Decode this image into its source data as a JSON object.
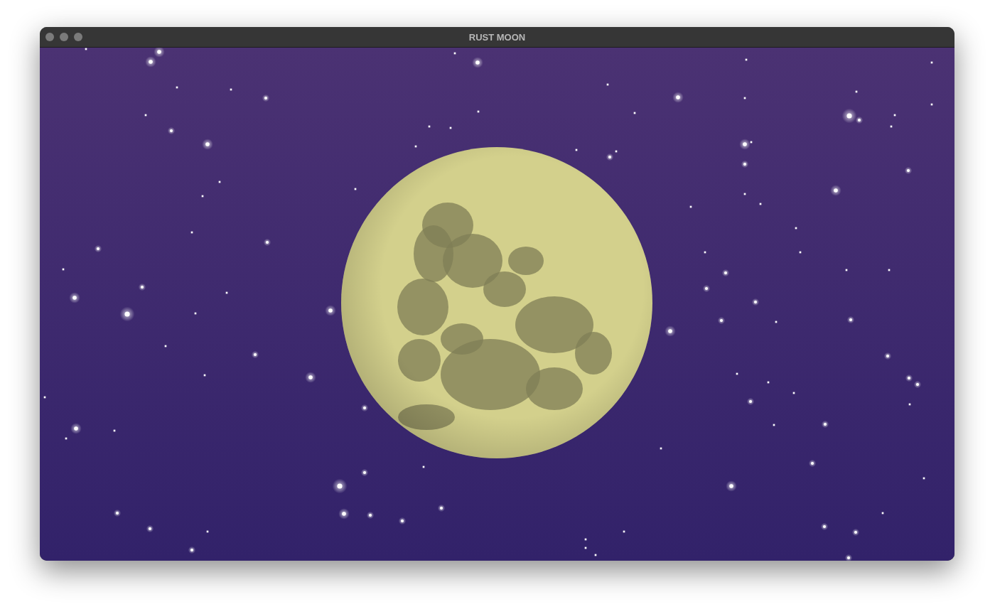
{
  "window": {
    "title": "RUST MOON"
  }
}
